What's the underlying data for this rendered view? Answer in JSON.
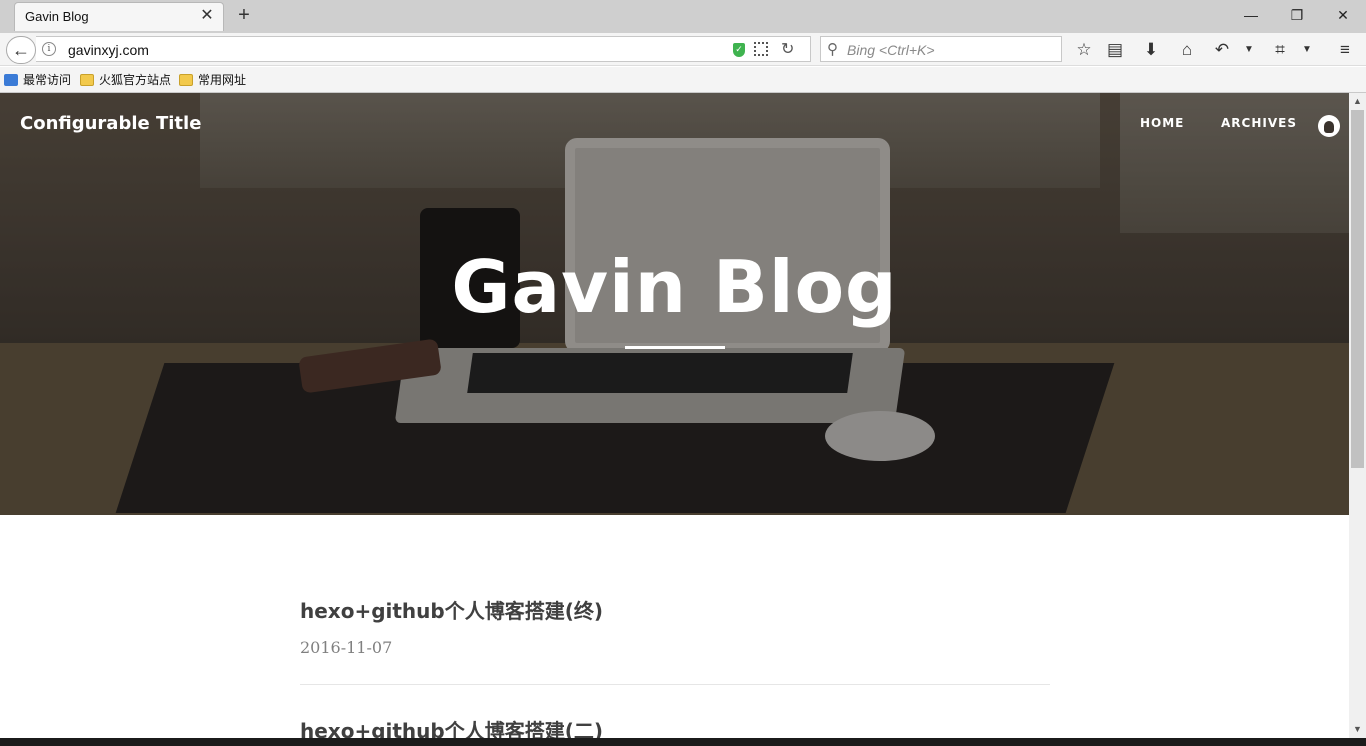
{
  "browser": {
    "tab": {
      "title": "Gavin Blog",
      "close": "✕"
    },
    "new_tab": "+",
    "window_controls": {
      "minimize": "—",
      "restore": "❐",
      "close": "✕"
    },
    "url": "gavinxyj.com",
    "search_placeholder": "Bing <Ctrl+K>",
    "bookmarks": [
      "最常访问",
      "火狐官方站点",
      "常用网址"
    ],
    "icons": [
      "back-arrow-icon",
      "info-icon",
      "shield-icon",
      "qr-code-icon",
      "reload-icon",
      "search-icon",
      "star-icon",
      "reading-list-icon",
      "download-icon",
      "home-icon",
      "undo-icon",
      "screenshot-icon",
      "menu-icon"
    ]
  },
  "site": {
    "brand": "Configurable Title",
    "nav": [
      "HOME",
      "ARCHIVES"
    ],
    "hero_title": "Gavin Blog"
  },
  "posts": [
    {
      "title": "hexo+github个人博客搭建(终)",
      "date": "2016-11-07"
    },
    {
      "title": "hexo+github个人博客搭建(二)",
      "date": ""
    }
  ]
}
